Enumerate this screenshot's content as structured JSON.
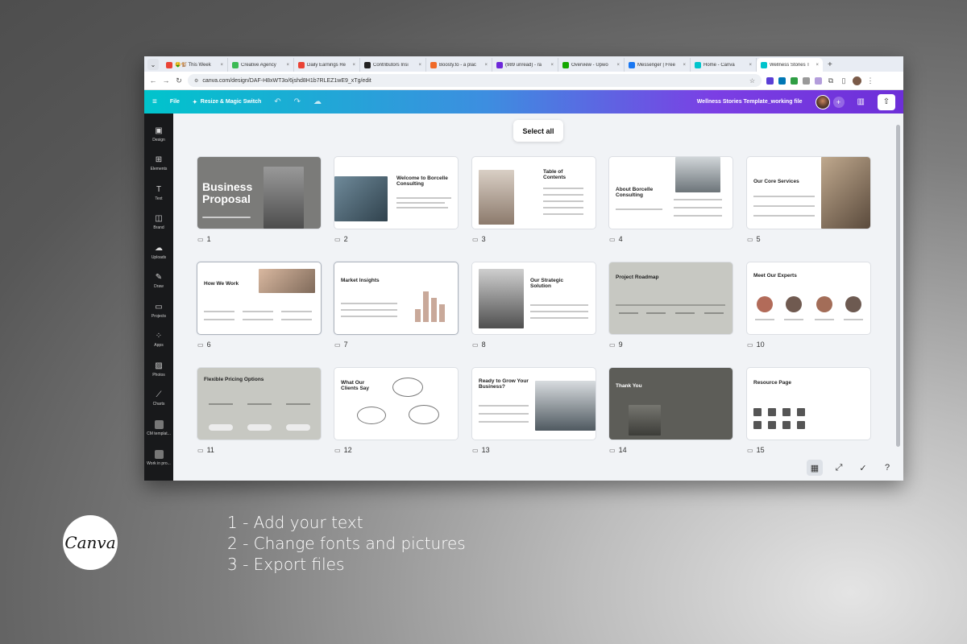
{
  "browser": {
    "tabs": [
      {
        "label": "🤑🐒 This Week",
        "color": "#ea4335"
      },
      {
        "label": "Creative Agency",
        "color": "#3cba54"
      },
      {
        "label": "Daily Earnings Re",
        "color": "#ea4335"
      },
      {
        "label": "Contributors Insi",
        "color": "#222222"
      },
      {
        "label": "Boosty.to - a plac",
        "color": "#f06a28"
      },
      {
        "label": "(989 unread) - ra",
        "color": "#6d28d9"
      },
      {
        "label": "Overview - Upwo",
        "color": "#14a800"
      },
      {
        "label": "Messenger | Free",
        "color": "#1877f2"
      },
      {
        "label": "Home - Canva",
        "color": "#00c4cc"
      },
      {
        "label": "Wellness Stories T",
        "color": "#00c4cc"
      }
    ],
    "new_tab": "+",
    "url": "canva.com/design/DAF-H8xWT3o/6jshd8H1b7RLEZ1wE9_xTg/edit"
  },
  "canva": {
    "file_label": "File",
    "resize_label": "Resize & Magic Switch",
    "doc_title": "Wellness Stories Template_working file",
    "select_all": "Select all",
    "sidebar": [
      {
        "label": "Design",
        "icon": "▣"
      },
      {
        "label": "Elements",
        "icon": "⊞"
      },
      {
        "label": "Text",
        "icon": "T"
      },
      {
        "label": "Brand",
        "icon": "◫"
      },
      {
        "label": "Uploads",
        "icon": "☁"
      },
      {
        "label": "Draw",
        "icon": "✎"
      },
      {
        "label": "Projects",
        "icon": "▭"
      },
      {
        "label": "Apps",
        "icon": "⁘"
      },
      {
        "label": "Photos",
        "icon": "▨"
      },
      {
        "label": "Charts",
        "icon": "⟋"
      },
      {
        "label": "CM templat...",
        "icon": "sq"
      },
      {
        "label": "Work in pro...",
        "icon": "sq"
      }
    ],
    "slides": [
      {
        "num": "1",
        "title": "Business Proposal"
      },
      {
        "num": "2",
        "title": "Welcome to Borcelle Consulting"
      },
      {
        "num": "3",
        "title": "Table of Contents"
      },
      {
        "num": "4",
        "title": "About Borcelle Consulting"
      },
      {
        "num": "5",
        "title": "Our Core Services"
      },
      {
        "num": "6",
        "title": "How We Work"
      },
      {
        "num": "7",
        "title": "Market Insights"
      },
      {
        "num": "8",
        "title": "Our Strategic Solution"
      },
      {
        "num": "9",
        "title": "Project Roadmap"
      },
      {
        "num": "10",
        "title": "Meet Our Experts"
      },
      {
        "num": "11",
        "title": "Flexible Pricing Options"
      },
      {
        "num": "12",
        "title": "What Our Clients Say"
      },
      {
        "num": "13",
        "title": "Ready to Grow Your Business?"
      },
      {
        "num": "14",
        "title": "Thank You"
      },
      {
        "num": "15",
        "title": "Resource Page"
      }
    ]
  },
  "caption": {
    "steps": [
      "1 - Add your text",
      "2 - Change fonts and pictures",
      "3 - Export files"
    ],
    "logo": "Canva"
  }
}
